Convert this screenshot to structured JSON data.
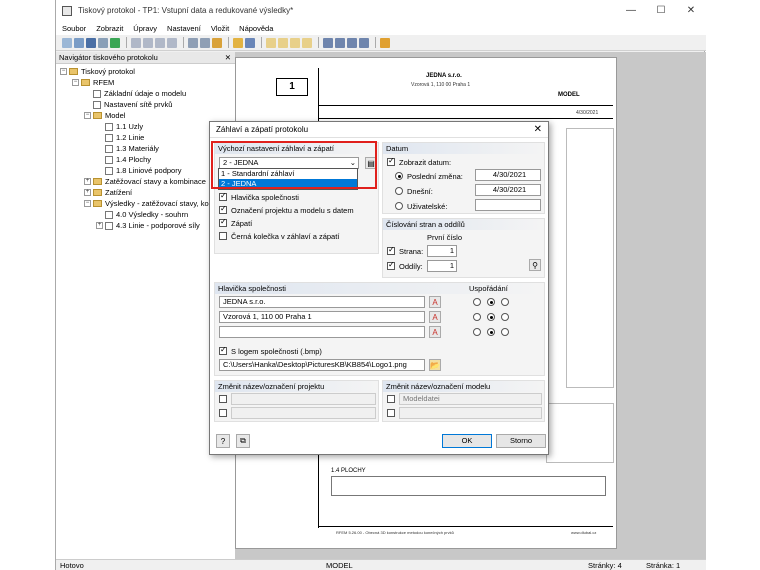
{
  "window": {
    "title": "Tiskový protokol - TP1: Vstupní data a redukované výsledky*"
  },
  "menu": [
    "Soubor",
    "Zobrazit",
    "Úpravy",
    "Nastavení",
    "Vložit",
    "Nápověda"
  ],
  "navigator": {
    "title": "Navigátor tiskového protokolu",
    "items": [
      {
        "label": "Tiskový protokol",
        "level": 0,
        "type": "folder",
        "exp": "−"
      },
      {
        "label": "RFEM",
        "level": 1,
        "type": "folder",
        "exp": "−"
      },
      {
        "label": "Základní údaje o modelu",
        "level": 2,
        "type": "doc",
        "exp": ""
      },
      {
        "label": "Nastavení sítě prvků",
        "level": 2,
        "type": "doc",
        "exp": ""
      },
      {
        "label": "Model",
        "level": 2,
        "type": "folder",
        "exp": "−"
      },
      {
        "label": "1.1 Uzly",
        "level": 3,
        "type": "doc",
        "exp": ""
      },
      {
        "label": "1.2 Linie",
        "level": 3,
        "type": "doc",
        "exp": ""
      },
      {
        "label": "1.3 Materiály",
        "level": 3,
        "type": "doc",
        "exp": ""
      },
      {
        "label": "1.4 Plochy",
        "level": 3,
        "type": "doc",
        "exp": ""
      },
      {
        "label": "1.8 Liniové podpory",
        "level": 3,
        "type": "doc",
        "exp": ""
      },
      {
        "label": "Zatěžovací stavy a kombinace",
        "level": 2,
        "type": "folder",
        "exp": "+"
      },
      {
        "label": "Zatížení",
        "level": 2,
        "type": "folder",
        "exp": "+"
      },
      {
        "label": "Výsledky - zatěžovací stavy, kom",
        "level": 2,
        "type": "folder",
        "exp": "−"
      },
      {
        "label": "4.0 Výsledky - souhrn",
        "level": 3,
        "type": "doc",
        "exp": ""
      },
      {
        "label": "4.3 Linie - podporové síly",
        "level": 3,
        "type": "doc",
        "exp": "+"
      }
    ]
  },
  "page_preview": {
    "number": "1",
    "company": "JEDNA s.r.o.",
    "address": "Vzorová 1, 110 00 Praha 1",
    "model": "MODEL",
    "date": "4/30/2021",
    "section": "1.4 PLOCHY",
    "footer_left": "RFEM 5.26.00 - Obecná 3D konstrukce metodou konečných prvků",
    "footer_right": "www.dlubal.cz"
  },
  "dialog": {
    "title": "Záhlaví a zápatí protokolu",
    "default_group": {
      "title": "Výchozí nastavení záhlaví a zápatí",
      "selected": "2 - JEDNA",
      "options": [
        "1 - Standardní záhlaví",
        "2 - JEDNA"
      ],
      "checkboxes": [
        {
          "label": "Hlavička společnosti",
          "checked": true
        },
        {
          "label": "Označení projektu a modelu s datem",
          "checked": true
        },
        {
          "label": "Zápatí",
          "checked": true
        },
        {
          "label": "Černá kolečka v záhlaví a zápatí",
          "checked": false
        }
      ]
    },
    "date_group": {
      "title": "Datum",
      "show_label": "Zobrazit datum:",
      "last_change_label": "Poslední změna:",
      "last_change_value": "4/30/2021",
      "today_label": "Dnešní:",
      "today_value": "4/30/2021",
      "user_label": "Uživatelské:"
    },
    "numbering_group": {
      "title": "Číslování stran a oddílů",
      "first_number_label": "První číslo",
      "page_label": "Strana:",
      "page_value": "1",
      "section_label": "Oddíly:",
      "section_value": "1"
    },
    "company_group": {
      "title": "Hlavička společnosti",
      "arrangement_title": "Uspořádání",
      "lines": [
        "JEDNA s.r.o.",
        "Vzorová 1, 110 00 Praha 1",
        ""
      ],
      "logo_label": "S logem společnosti (.bmp)",
      "logo_path": "C:\\Users\\Hanka\\Desktop\\PicturesKB\\KB854\\Logo1.png"
    },
    "rename_project": {
      "title": "Změnit název/označení projektu"
    },
    "rename_model": {
      "title": "Změnit název/označení modelu",
      "placeholder": "Modeldatei"
    },
    "ok_label": "OK",
    "cancel_label": "Storno"
  },
  "status": {
    "left": "Hotovo",
    "center": "MODEL",
    "pages": "Stránky: 4",
    "page": "Stránka: 1"
  }
}
